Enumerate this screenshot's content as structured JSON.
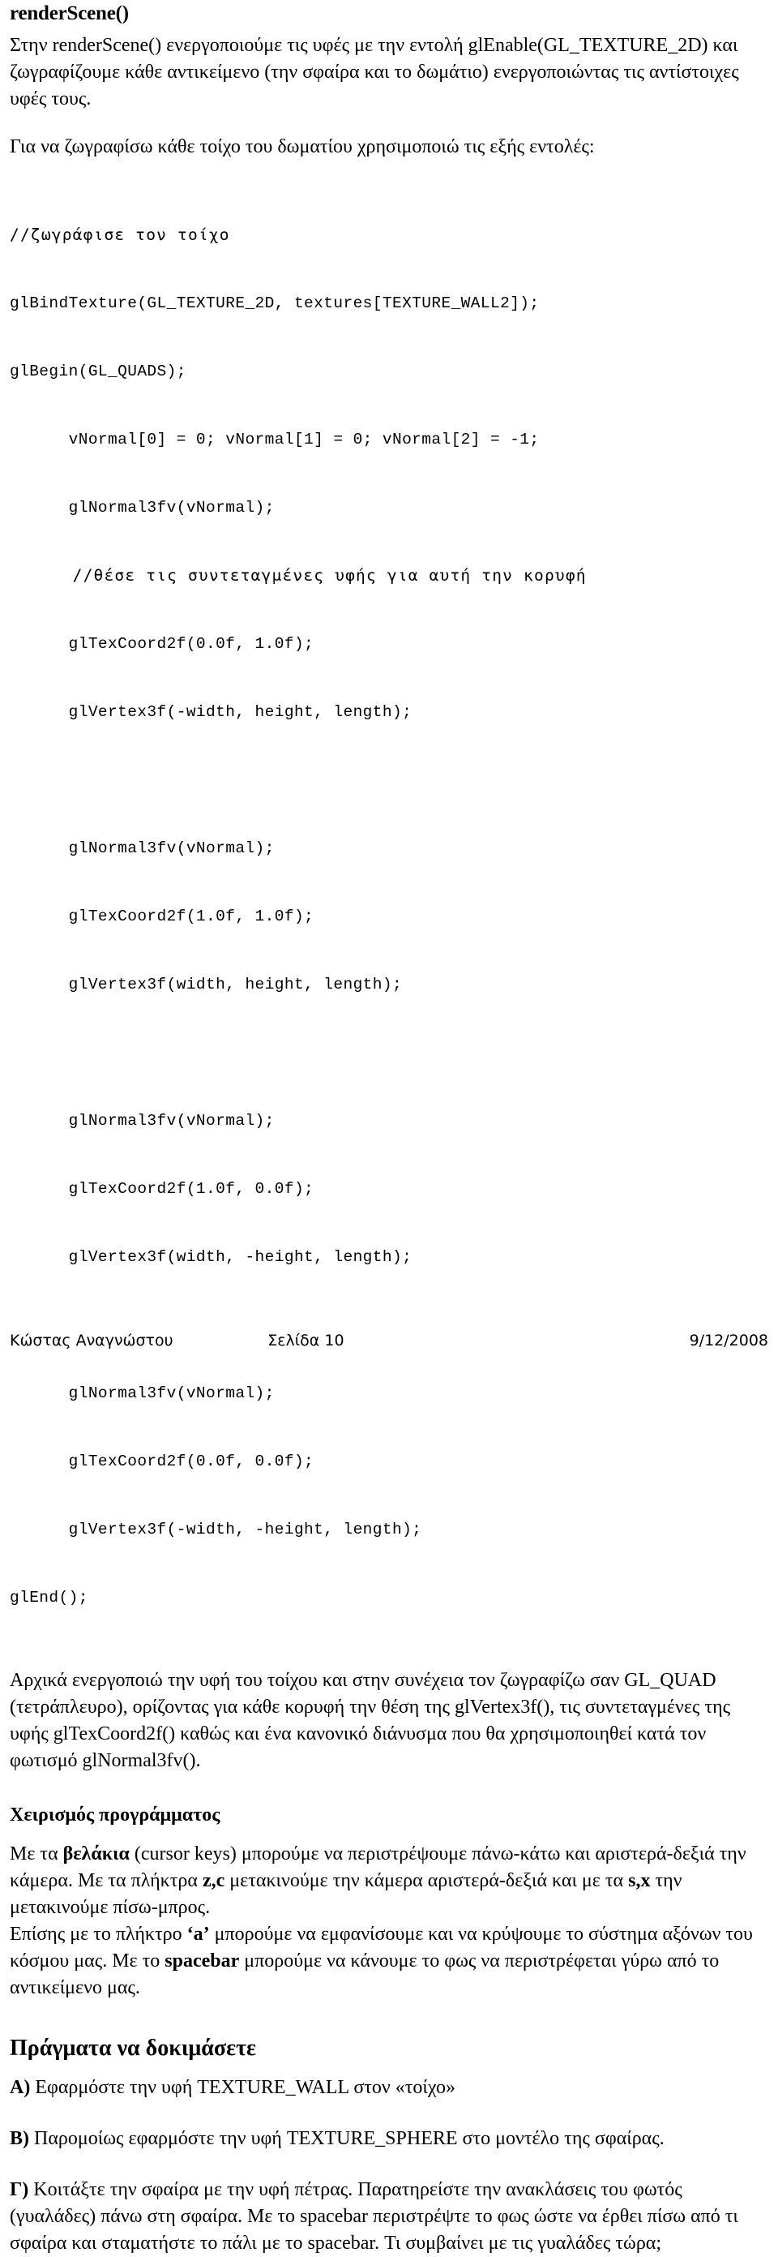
{
  "document": {
    "heading_function": "renderScene()",
    "intro_paragraph": "Στην renderScene() ενεργοποιούμε τις υφές  με την εντολή glEnable(GL_TEXTURE_2D) και ζωγραφίζουμε κάθε αντικείμενο (την σφαίρα και το δωμάτιο) ενεργοποιώντας τις αντίστοιχες υφές τους.",
    "walls_paragraph": "Για να ζωγραφίσω κάθε τοίχο του δωματίου χρησιμοποιώ τις εξής εντολές:",
    "code_lines": [
      "//ζωγράφισε τον τοίχο",
      "glBindTexture(GL_TEXTURE_2D, textures[TEXTURE_WALL2]);",
      "glBegin(GL_QUADS);",
      "      vNormal[0] = 0; vNormal[1] = 0; vNormal[2] = -1;",
      "      glNormal3fv(vNormal);",
      "      //θέσε τις συντεταγμένες υφής για αυτή την κορυφή",
      "      glTexCoord2f(0.0f, 1.0f);",
      "      glVertex3f(-width, height, length);",
      "",
      "      glNormal3fv(vNormal);",
      "      glTexCoord2f(1.0f, 1.0f);",
      "      glVertex3f(width, height, length);",
      "",
      "      glNormal3fv(vNormal);",
      "      glTexCoord2f(1.0f, 0.0f);",
      "      glVertex3f(width, -height, length);",
      "",
      "      glNormal3fv(vNormal);",
      "      glTexCoord2f(0.0f, 0.0f);",
      "      glVertex3f(-width, -height, length);",
      "glEnd();"
    ],
    "code_greek_line_indexes": [
      0,
      5
    ],
    "explain_paragraph": "Αρχικά ενεργοποιώ την υφή του τοίχου και στην συνέχεια τον ζωγραφίζω σαν GL_QUAD (τετράπλευρο), ορίζοντας για κάθε κορυφή την θέση της glVertex3f(), τις συντεταγμένες της υφής glTexCoord2f() καθώς και ένα κανονικό διάνυσμα που θα χρησιμοποιηθεί κατά τον φωτισμό glNormal3fv().",
    "heading_controls": "Χειρισμός προγράμματος",
    "controls_paragraph_1_parts": [
      {
        "text": "Με τα ",
        "bold": false
      },
      {
        "text": "βελάκια",
        "bold": true
      },
      {
        "text": " (cursor keys) μπορούμε να περιστρέψουμε πάνω-κάτω και αριστερά-δεξιά την κάμερα. Με τα πλήκτρα ",
        "bold": false
      },
      {
        "text": "z,c",
        "bold": true
      },
      {
        "text": " μετακινούμε την κάμερα αριστερά-δεξιά και με τα ",
        "bold": false
      },
      {
        "text": "s,x",
        "bold": true
      },
      {
        "text": " την μετακινούμε πίσω-μπρος.",
        "bold": false
      }
    ],
    "controls_paragraph_2_parts": [
      {
        "text": " Επίσης με το πλήκτρο ",
        "bold": false
      },
      {
        "text": "‘a’",
        "bold": true
      },
      {
        "text": " μπορούμε να εμφανίσουμε και να κρύψουμε το σύστημα αξόνων του κόσμου μας. Με το ",
        "bold": false
      },
      {
        "text": "spacebar",
        "bold": true
      },
      {
        "text": " μπορούμε να κάνουμε το φως να περιστρέφεται γύρω από το αντικείμενο μας.",
        "bold": false
      }
    ],
    "heading_exercises": "Πράγματα να δοκιμάσετε",
    "exercises": [
      {
        "label": "Α)",
        "text": " Εφαρμόστε την υφή TEXTURE_WALL στον «τοίχο»"
      },
      {
        "label": "Β)",
        "text": " Παρομοίως εφαρμόστε την υφή TEXTURE_SPHERE στο μοντέλο της σφαίρας."
      },
      {
        "label": "Γ)",
        "text": " Κοιτάξτε την σφαίρα με την υφή πέτρας. Παρατηρείστε την ανακλάσεις του φωτός (γυαλάδες) πάνω στη σφαίρα. Με το spacebar περιστρέψτε το φως ώστε να έρθει πίσω από τι σφαίρα και σταματήστε το πάλι με το spacebar. Τι συμβαίνει με τις γυαλάδες τώρα;"
      }
    ]
  },
  "footer": {
    "author": "Κώστας Αναγνώστου",
    "page": "Σελίδα 10",
    "date": "9/12/2008"
  }
}
